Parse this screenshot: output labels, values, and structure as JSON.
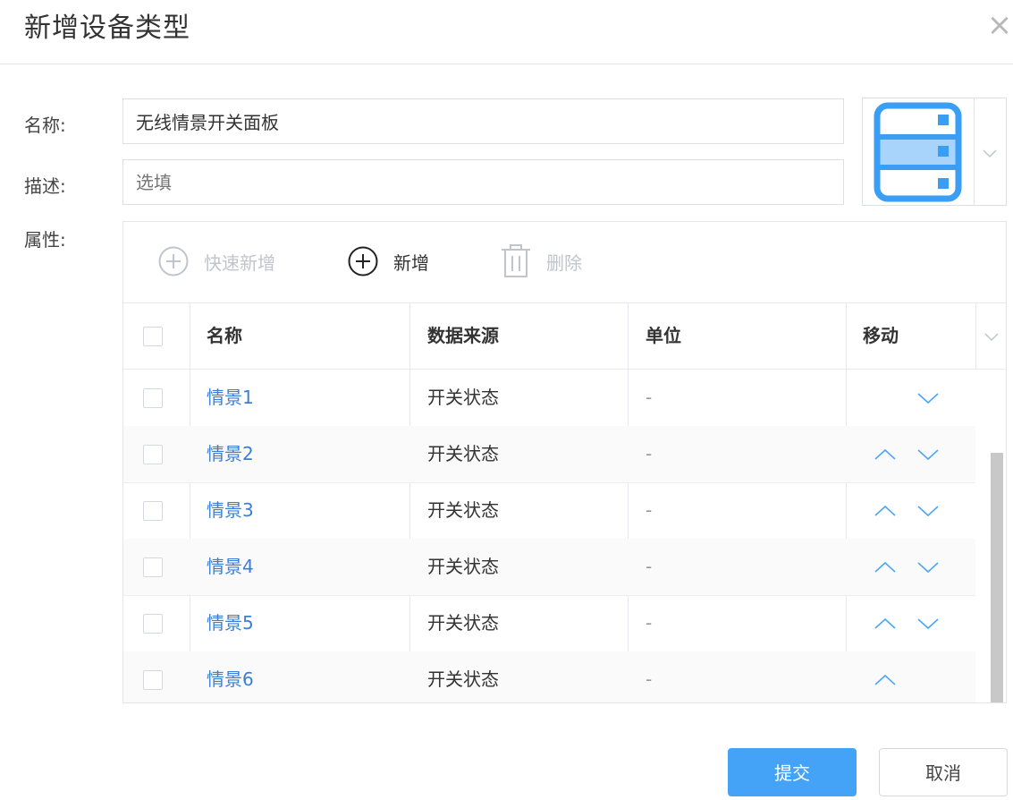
{
  "dialog": {
    "title": "新增设备类型",
    "close_glyph": "×"
  },
  "form": {
    "name_label": "名称:",
    "name_value": "无线情景开关面板",
    "desc_label": "描述:",
    "desc_placeholder": "选填",
    "attr_label": "属性:",
    "icon_picker": {
      "icon": "server-rack-icon",
      "accent": "#3a9ef5",
      "highlight": "#a8d4fb"
    }
  },
  "toolbar": {
    "quick_add_label": "快速新增",
    "add_label": "新增",
    "delete_label": "删除"
  },
  "table": {
    "columns": {
      "name": "名称",
      "source": "数据来源",
      "unit": "单位",
      "move": "移动"
    },
    "rows": [
      {
        "name": "情景1",
        "source": "开关状态",
        "unit": "-",
        "up": false,
        "down": true
      },
      {
        "name": "情景2",
        "source": "开关状态",
        "unit": "-",
        "up": true,
        "down": true
      },
      {
        "name": "情景3",
        "source": "开关状态",
        "unit": "-",
        "up": true,
        "down": true
      },
      {
        "name": "情景4",
        "source": "开关状态",
        "unit": "-",
        "up": true,
        "down": true
      },
      {
        "name": "情景5",
        "source": "开关状态",
        "unit": "-",
        "up": true,
        "down": true
      },
      {
        "name": "情景6",
        "source": "开关状态",
        "unit": "-",
        "up": true,
        "down": false
      }
    ]
  },
  "footer": {
    "submit_label": "提交",
    "cancel_label": "取消"
  },
  "colors": {
    "primary": "#44a3f7",
    "link": "#3b7fd5",
    "disabled": "#c0c4cc",
    "arrow": "#4da6f5"
  }
}
